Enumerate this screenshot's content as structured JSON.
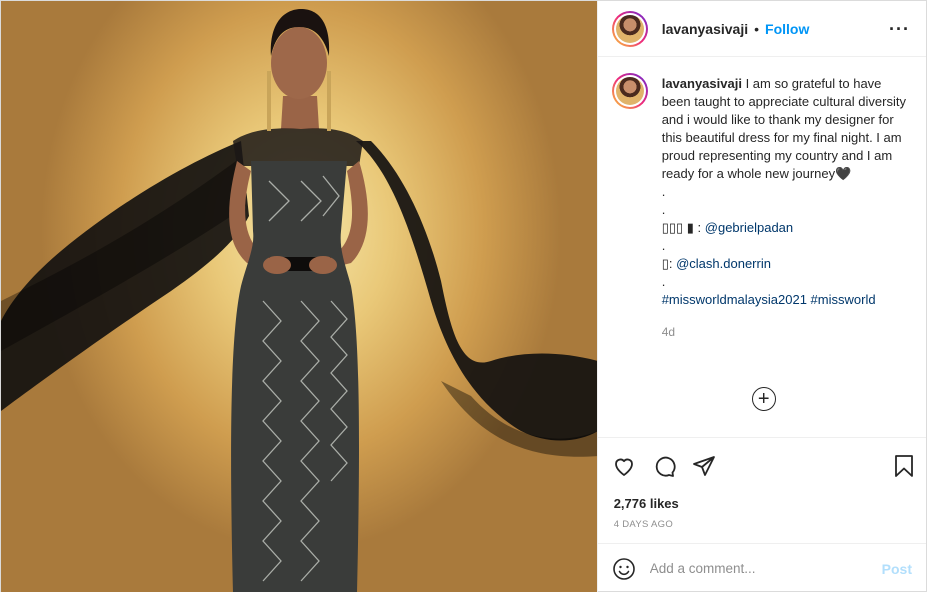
{
  "header": {
    "username": "lavanyasivaji",
    "separator": "•",
    "follow_label": "Follow",
    "more_label": "···"
  },
  "caption": {
    "username": "lavanyasivaji",
    "text": "I am so grateful to have been taught to appreciate cultural diversity and i would like to thank my designer for this beautiful dress for my final night. I am proud representing my country and I am ready for a whole new journey🖤",
    "dot1": ".",
    "dot2": ".",
    "designer_prefix": "▯▯▯ ▮ : ",
    "designer_handle": "@gebrielpadan",
    "dot3": ".",
    "photo_prefix": "▯: ",
    "photo_handle": "@clash.donerrin",
    "dot4": ".",
    "hashtags": "#missworldmalaysia2021 #missworld",
    "age": "4d"
  },
  "more_comments_label": "+",
  "icons": {
    "like": "heart-icon",
    "comment": "comment-bubble-icon",
    "share": "paper-plane-icon",
    "save": "bookmark-icon",
    "emoji": "smiley-icon",
    "more": "more-options-icon",
    "load_more": "plus-circle-icon"
  },
  "likes_label": "2,776 likes",
  "date_label": "4 DAYS AGO",
  "comment_box": {
    "placeholder": "Add a comment...",
    "value": "",
    "post_label": "Post"
  },
  "colors": {
    "link": "#0095f6",
    "post_disabled": "#b2dffc",
    "muted": "#8e8e8e"
  }
}
